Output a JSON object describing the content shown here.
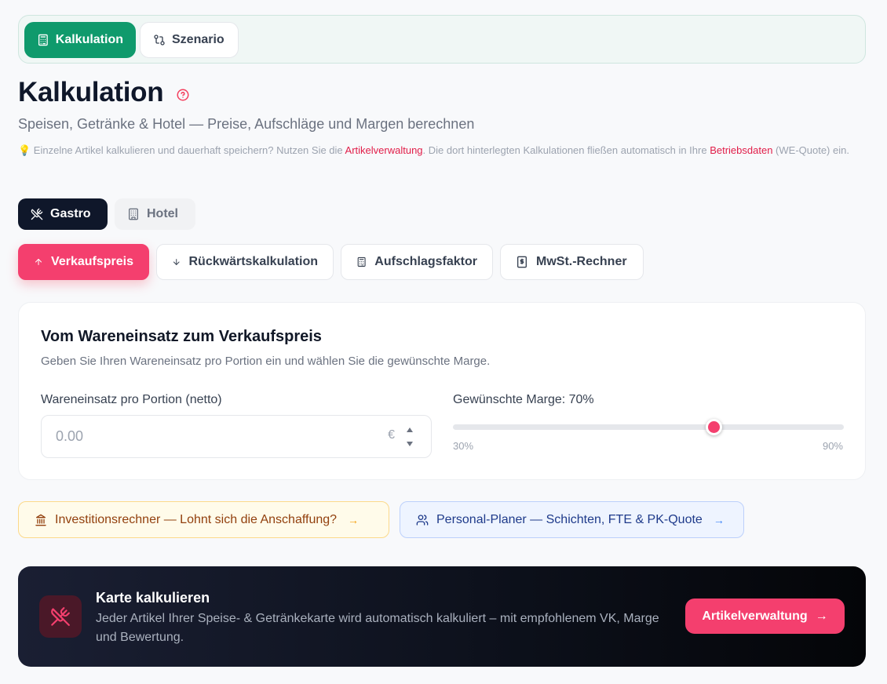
{
  "top_tabs": [
    {
      "label": "Kalkulation",
      "icon": "calculator-icon",
      "active": true
    },
    {
      "label": "Szenario",
      "icon": "git-compare-icon",
      "active": false
    }
  ],
  "header": {
    "title": "Kalkulation",
    "subtitle": "Speisen, Getränke & Hotel — Preise, Aufschläge und Margen berechnen",
    "hint_prefix": "💡 Einzelne Artikel kalkulieren und dauerhaft speichern? Nutzen Sie die ",
    "hint_link1": "Artikelverwaltung",
    "hint_middle": ". Die dort hinterlegten Kalkulationen fließen automatisch in Ihre ",
    "hint_link2": "Betriebsdaten",
    "hint_suffix": " (WE-Quote) ein."
  },
  "modes": [
    {
      "label": "Gastro",
      "icon": "utensils-crossed-icon",
      "active": true
    },
    {
      "label": "Hotel",
      "icon": "building-icon",
      "active": false
    }
  ],
  "calc_tabs": [
    {
      "label": "Verkaufspreis",
      "icon": "arrow-up-icon",
      "active": true
    },
    {
      "label": "Rückwärtskalkulation",
      "icon": "arrow-down-icon",
      "active": false
    },
    {
      "label": "Aufschlagsfaktor",
      "icon": "calculator-icon",
      "active": false
    },
    {
      "label": "MwSt.-Rechner",
      "icon": "receipt-icon",
      "active": false
    }
  ],
  "card": {
    "title": "Vom Wareneinsatz zum Verkaufspreis",
    "description": "Geben Sie Ihren Wareneinsatz pro Portion ein und wählen Sie die gewünschte Marge.",
    "input_label": "Wareneinsatz pro Portion (netto)",
    "input_placeholder": "0.00",
    "input_value": "",
    "currency": "€",
    "margin_label": "Gewünschte Marge: 70%",
    "margin_value": 70,
    "slider_min": 30,
    "slider_max": 90,
    "slider_min_label": "30%",
    "slider_max_label": "90%"
  },
  "links": [
    {
      "label": "Investitionsrechner — Lohnt sich die Anschaffung?",
      "icon": "landmark-icon"
    },
    {
      "label": "Personal-Planer — Schichten, FTE & PK-Quote",
      "icon": "users-icon"
    }
  ],
  "banner": {
    "title": "Karte kalkulieren",
    "text": "Jeder Artikel Ihrer Speise- & Getränkekarte wird automatisch kalkuliert – mit empfohlenem VK, Marge und Bewertung.",
    "button_label": "Artikelverwaltung",
    "icon": "utensils-crossed-icon"
  },
  "colors": {
    "brand_green": "#0f9a6c",
    "accent_pink": "#f43f6e",
    "dark": "#0f172a"
  }
}
